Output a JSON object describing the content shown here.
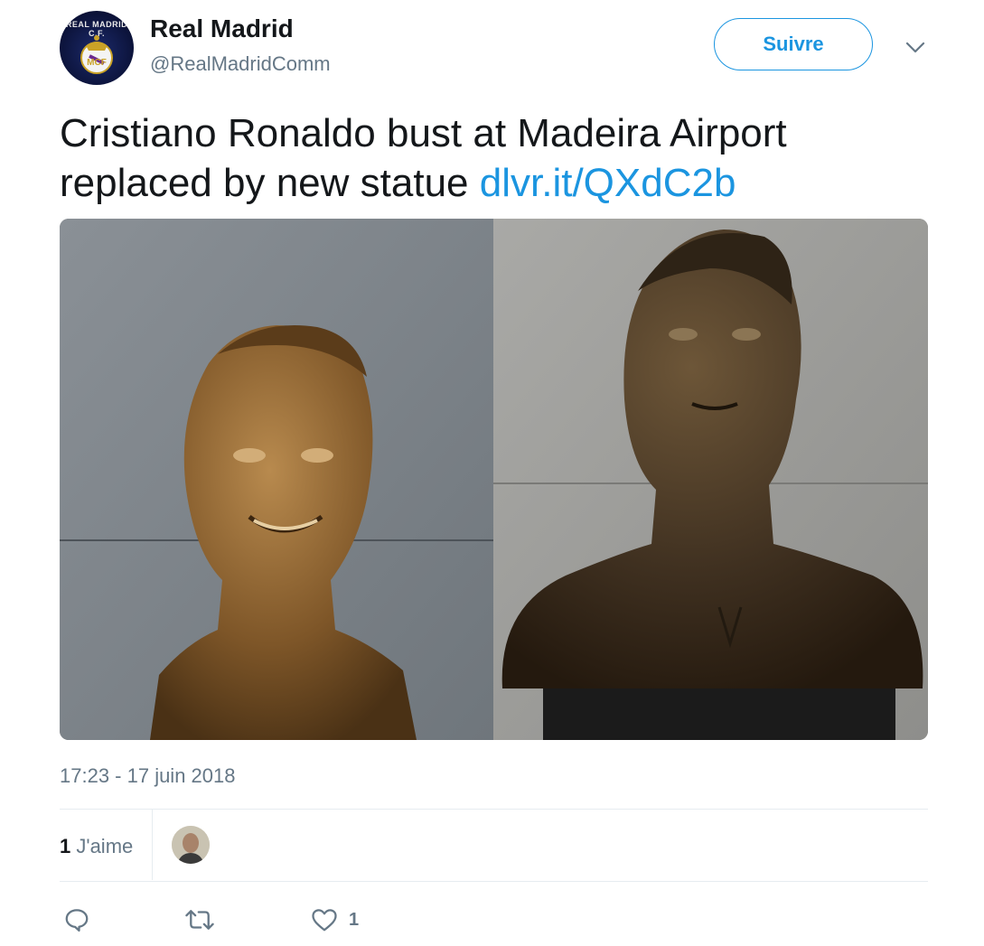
{
  "account": {
    "name": "Real Madrid",
    "handle": "@RealMadridComm",
    "avatar_text": "REAL MADRID C.F.",
    "avatar_icon": "real-madrid-crest"
  },
  "follow_label": "Suivre",
  "menu_icon": "chevron-down-icon",
  "tweet": {
    "text": "Cristiano Ronaldo bust at Madeira Airport replaced by new statue",
    "link": "dlvr.it/QXdC2b"
  },
  "media_icon": "photo-bust-comparison",
  "timestamp": "17:23 - 17 juin 2018",
  "likes": {
    "count": "1",
    "label": "J'aime"
  },
  "actions": {
    "reply_icon": "reply-icon",
    "retweet_icon": "retweet-icon",
    "like_icon": "heart-icon",
    "like_count": "1"
  },
  "colors": {
    "accent": "#1b95e0",
    "secondary_text": "#657786",
    "divider": "#e6ecf0"
  }
}
